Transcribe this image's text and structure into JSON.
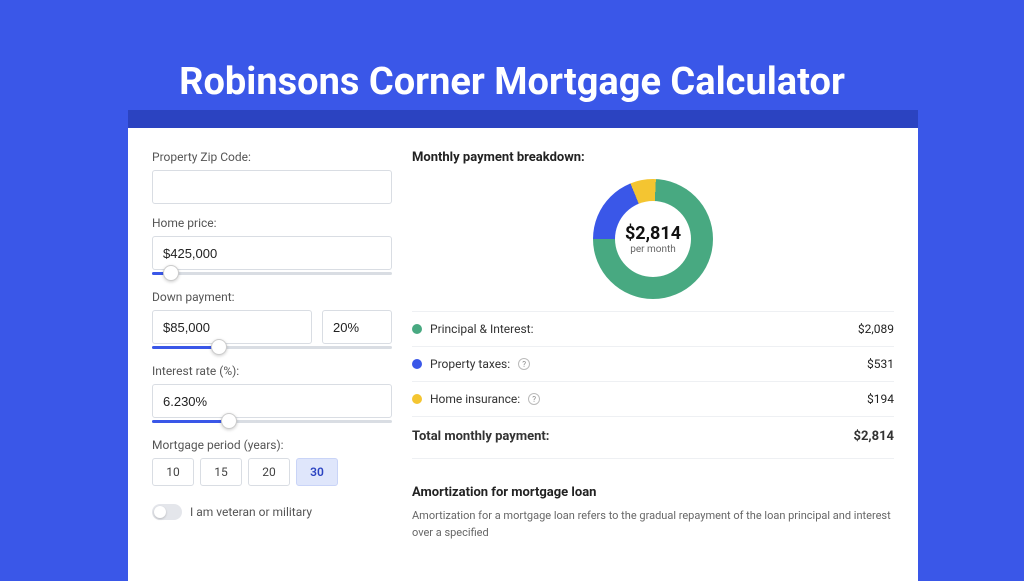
{
  "header": {
    "title": "Robinsons Corner Mortgage Calculator"
  },
  "left": {
    "zip": {
      "label": "Property Zip Code:",
      "value": ""
    },
    "home": {
      "label": "Home price:",
      "value": "$425,000",
      "slider_pct": 8
    },
    "down": {
      "label": "Down payment:",
      "amount": "$85,000",
      "pct": "20%",
      "slider_pct": 28
    },
    "rate": {
      "label": "Interest rate (%):",
      "value": "6.230%",
      "slider_pct": 32
    },
    "period": {
      "label": "Mortgage period (years):",
      "options": [
        "10",
        "15",
        "20",
        "30"
      ],
      "selected": "30"
    },
    "veteran": {
      "label": "I am veteran or military",
      "on": false
    }
  },
  "right": {
    "breakdown_title": "Monthly payment breakdown:",
    "donut": {
      "amount": "$2,814",
      "sub": "per month"
    },
    "rows": [
      {
        "color": "#48a981",
        "label": "Principal & Interest:",
        "amount": "$2,089"
      },
      {
        "color": "#3a57e8",
        "label": "Property taxes:",
        "amount": "$531",
        "help": true
      },
      {
        "color": "#f4c531",
        "label": "Home insurance:",
        "amount": "$194",
        "help": true
      }
    ],
    "total": {
      "label": "Total monthly payment:",
      "amount": "$2,814"
    },
    "amort": {
      "title": "Amortization for mortgage loan",
      "body": "Amortization for a mortgage loan refers to the gradual repayment of the loan principal and interest over a specified"
    }
  },
  "chart_data": {
    "type": "pie",
    "title": "Monthly payment breakdown",
    "center_label": "$2,814 per month",
    "categories": [
      "Principal & Interest",
      "Property taxes",
      "Home insurance"
    ],
    "values": [
      2089,
      531,
      194
    ],
    "colors": [
      "#48a981",
      "#3a57e8",
      "#f4c531"
    ]
  }
}
